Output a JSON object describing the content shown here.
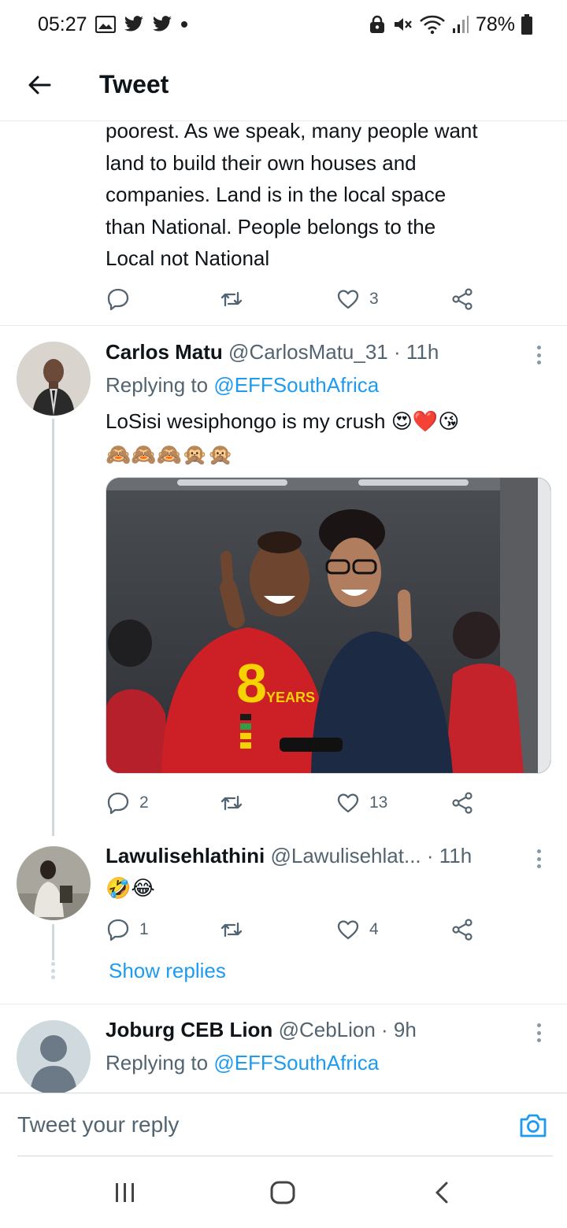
{
  "status_bar": {
    "time": "05:27",
    "battery": "78%",
    "icons": [
      "gallery-icon",
      "twitter-icon",
      "twitter-icon",
      "dot-icon",
      "lock-icon",
      "mute-icon",
      "wifi-icon",
      "signal-icon",
      "battery-icon"
    ]
  },
  "header": {
    "title": "Tweet",
    "back_icon": "arrow-left-icon"
  },
  "main_tweet": {
    "text_lines": [
      "poorest. As we speak, many people want",
      "land to build their own houses and",
      "companies. Land is in the local space",
      "than National. People belongs to the",
      "Local not National"
    ],
    "actions": {
      "reply_count": "",
      "retweet_count": "",
      "like_count": "3"
    }
  },
  "replies": [
    {
      "name": "Carlos Matu",
      "handle_time": "@CarlosMatu_31 · 11h",
      "replying_label": "Replying to",
      "replying_handle": "@EFFSouthAfrica",
      "text": "LoSisi wesiphongo is my crush",
      "text_emoji": "😍❤️😘",
      "emoji_line": "🙈🙈🙈🙊🙊",
      "media": "photo",
      "actions": {
        "reply_count": "2",
        "retweet_count": "",
        "like_count": "13"
      }
    },
    {
      "name": "Lawulisehlathini",
      "handle_time": "@Lawulisehlat... · 11h",
      "text_emoji": "🤣😂",
      "actions": {
        "reply_count": "1",
        "retweet_count": "",
        "like_count": "4"
      },
      "show_replies": "Show replies"
    },
    {
      "name": "Joburg CEB Lion",
      "handle_time": "@CebLion · 9h",
      "replying_label": "Replying to",
      "replying_handle": "@EFFSouthAfrica"
    }
  ],
  "reply_bar": {
    "placeholder": "Tweet your reply",
    "camera_icon": "camera-icon"
  },
  "nav_bar": {
    "icons": [
      "recent-apps-icon",
      "home-icon",
      "back-icon"
    ]
  },
  "colors": {
    "accent": "#1d9bf0",
    "text": "#0f1419",
    "muted": "#536471",
    "divider": "#e6ecf0"
  }
}
